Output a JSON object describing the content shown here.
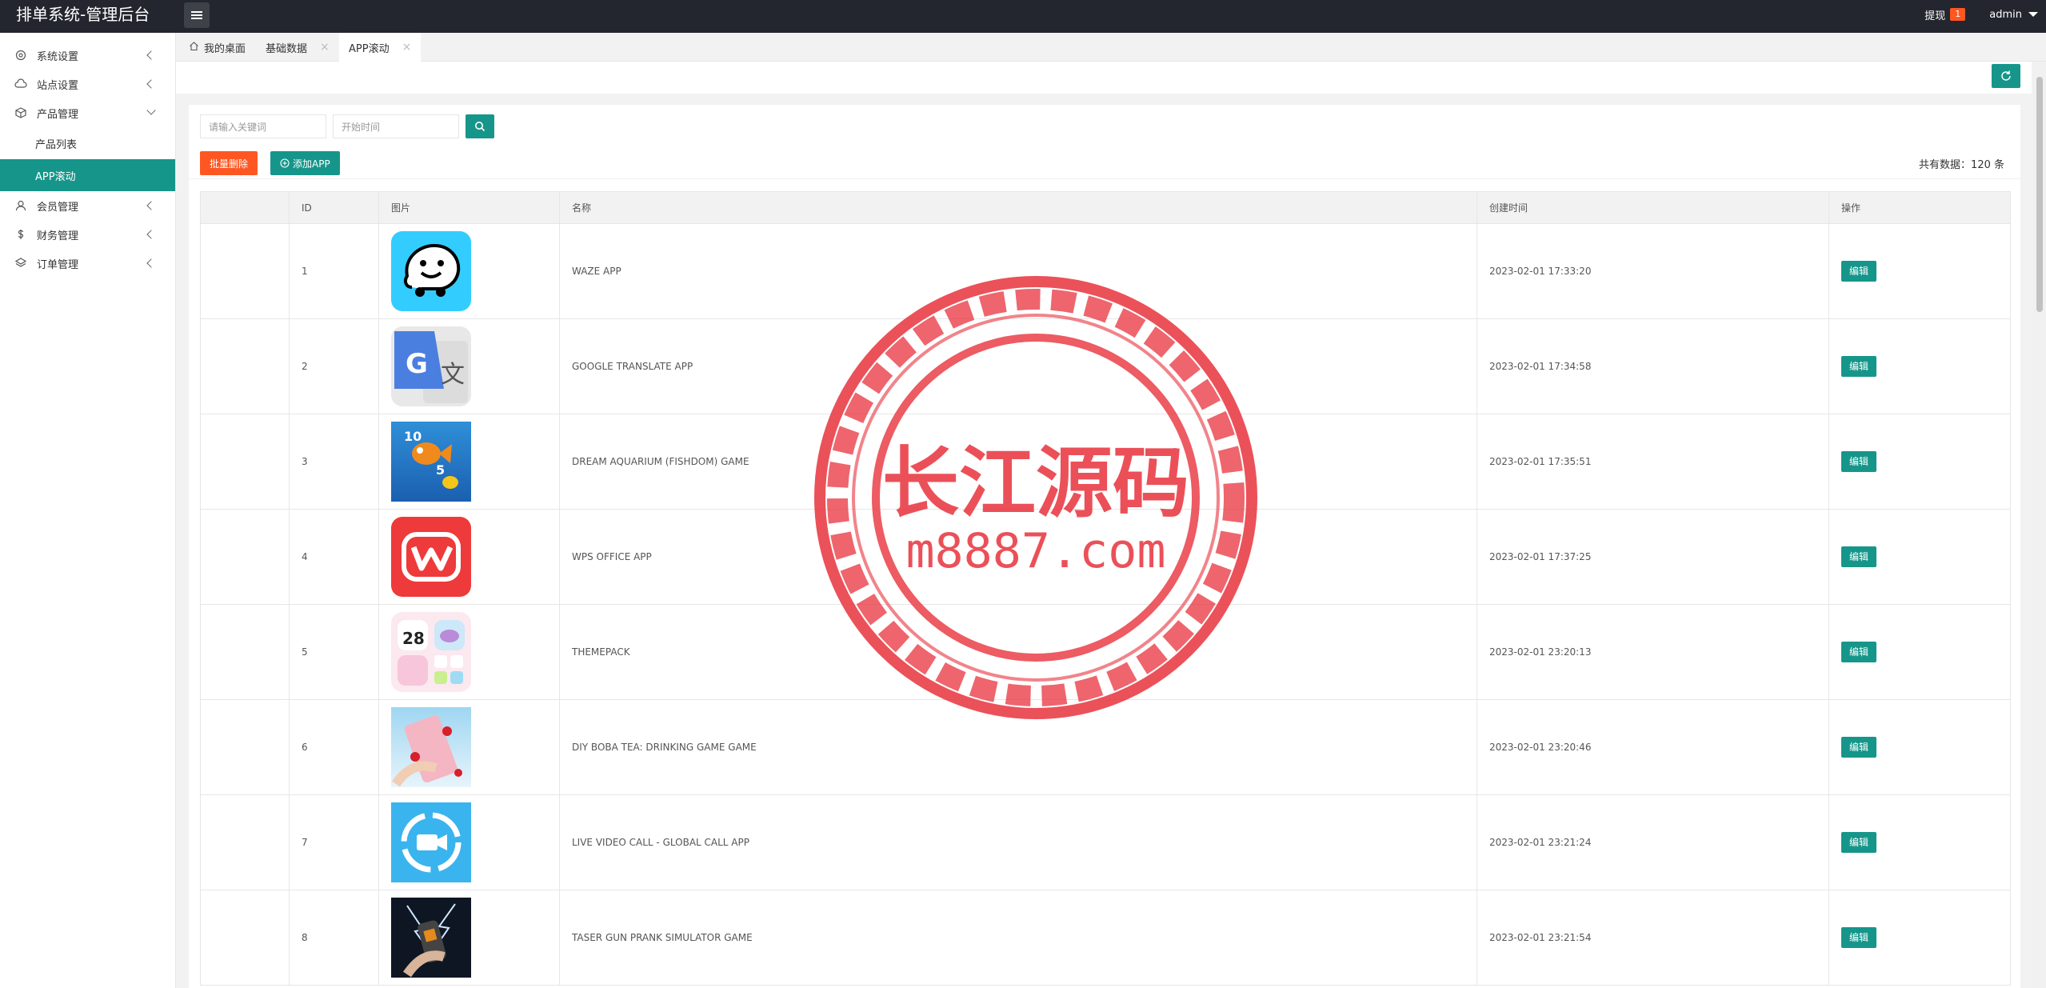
{
  "header": {
    "title": "排单系统-管理后台",
    "withdraw_label": "提现",
    "withdraw_count": "1",
    "user": "admin"
  },
  "sidebar": {
    "items": [
      {
        "label": "系统设置",
        "icon": "gear-icon"
      },
      {
        "label": "站点设置",
        "icon": "cloud-icon"
      },
      {
        "label": "产品管理",
        "icon": "box-icon"
      },
      {
        "label": "会员管理",
        "icon": "user-icon"
      },
      {
        "label": "财务管理",
        "icon": "dollar-icon"
      },
      {
        "label": "订单管理",
        "icon": "layers-icon"
      }
    ],
    "sub_items": [
      {
        "label": "产品列表"
      },
      {
        "label": "APP滚动"
      }
    ]
  },
  "tabs": [
    {
      "label": "我的桌面"
    },
    {
      "label": "基础数据"
    },
    {
      "label": "APP滚动"
    }
  ],
  "search": {
    "keyword_placeholder": "请输入关键词",
    "time_placeholder": "开始时间"
  },
  "actions": {
    "batch_delete": "批量删除",
    "add_app": "添加APP"
  },
  "total_label": "共有数据：120 条",
  "table": {
    "headers": [
      "ID",
      "图片",
      "名称",
      "创建时间",
      "操作"
    ],
    "edit_label": "编辑",
    "rows": [
      {
        "id": "1",
        "name": "WAZE APP",
        "created": "2023-02-01 17:33:20",
        "icon": "waze-icon"
      },
      {
        "id": "2",
        "name": "GOOGLE TRANSLATE APP",
        "created": "2023-02-01 17:34:58",
        "icon": "google-translate-icon"
      },
      {
        "id": "3",
        "name": "DREAM AQUARIUM (FISHDOM) GAME",
        "created": "2023-02-01 17:35:51",
        "icon": "fishdom-icon"
      },
      {
        "id": "4",
        "name": "WPS OFFICE APP",
        "created": "2023-02-01 17:37:25",
        "icon": "wps-icon"
      },
      {
        "id": "5",
        "name": "THEMEPACK",
        "created": "2023-02-01 23:20:13",
        "icon": "themepack-icon"
      },
      {
        "id": "6",
        "name": "DIY BOBA TEA: DRINKING GAME GAME",
        "created": "2023-02-01 23:20:46",
        "icon": "boba-tea-icon"
      },
      {
        "id": "7",
        "name": "LIVE VIDEO CALL - GLOBAL CALL APP",
        "created": "2023-02-01 23:21:24",
        "icon": "video-call-icon"
      },
      {
        "id": "8",
        "name": "TASER GUN PRANK SIMULATOR GAME",
        "created": "2023-02-01 23:21:54",
        "icon": "taser-icon"
      }
    ]
  },
  "watermark": {
    "line1": "长江源码",
    "line2": "m8887.com"
  },
  "colors": {
    "primary": "#16968a",
    "danger": "#ff5722",
    "topbar": "#23262e"
  }
}
